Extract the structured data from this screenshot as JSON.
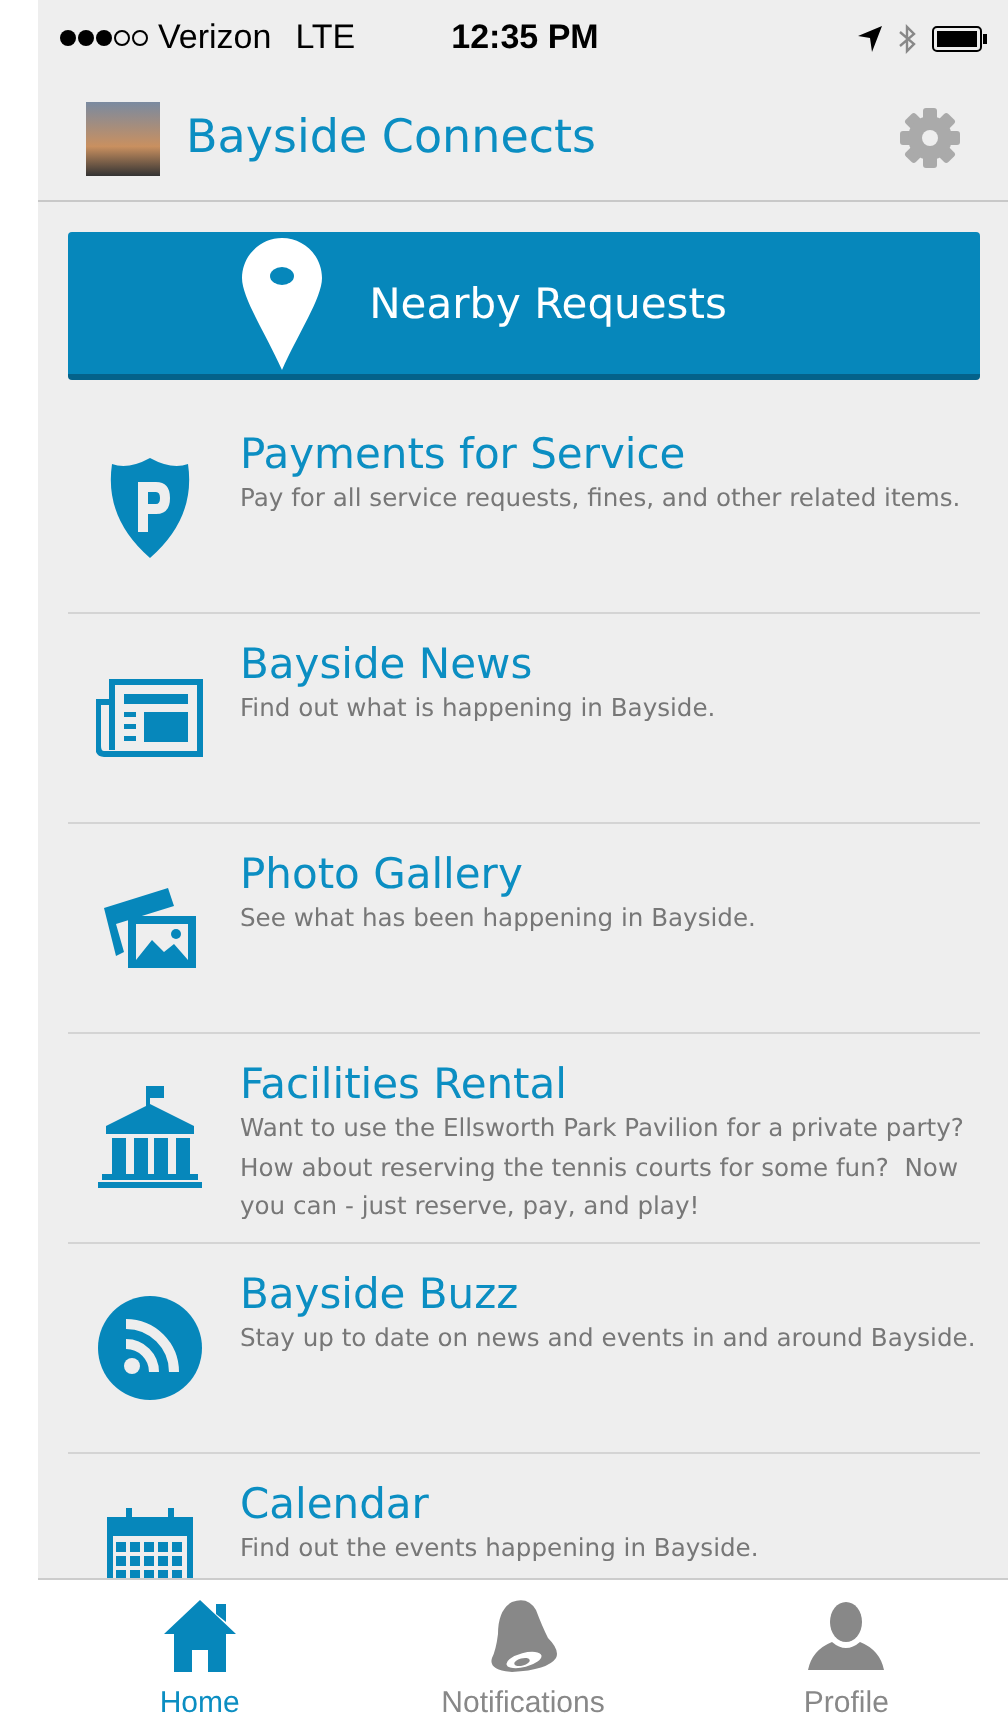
{
  "status_bar": {
    "carrier": "Verizon",
    "network": "LTE",
    "time": "12:35 PM"
  },
  "header": {
    "title": "Bayside Connects"
  },
  "nearby_button": {
    "label": "Nearby Requests"
  },
  "menu_items": [
    {
      "title": "Payments for Service",
      "description": "Pay for all service requests, fines, and other related items."
    },
    {
      "title": "Bayside News",
      "description": "Find out what is happening in Bayside."
    },
    {
      "title": "Photo Gallery",
      "description": "See what has been happening in Bayside."
    },
    {
      "title": "Facilities Rental",
      "description": "Want to use the Ellsworth Park Pavilion for a private party?  How about reserving the tennis courts for some fun?  Now you can - just reserve, pay, and play!"
    },
    {
      "title": "Bayside Buzz",
      "description": "Stay up to date on news and events in and around Bayside."
    },
    {
      "title": "Calendar",
      "description": "Find out the events happening in Bayside."
    }
  ],
  "tab_bar": [
    {
      "label": "Home",
      "selected": true
    },
    {
      "label": "Notifications",
      "selected": false
    },
    {
      "label": "Profile",
      "selected": false
    }
  ]
}
